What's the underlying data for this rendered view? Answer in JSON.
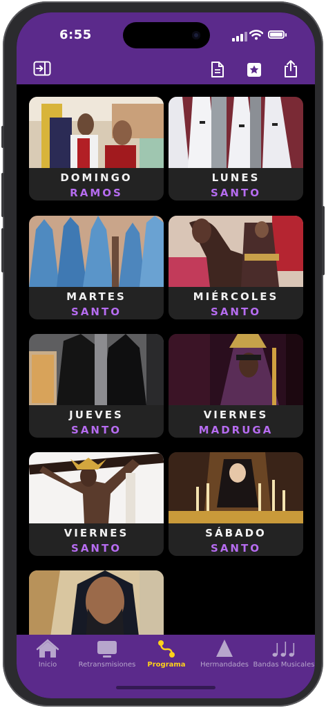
{
  "status": {
    "time": "6:55"
  },
  "toolbar": {
    "icons": [
      "sidebar-toggle-icon",
      "document-icon",
      "star-icon",
      "share-icon"
    ]
  },
  "days": [
    {
      "line1": "DOMINGO",
      "line2": "RAMOS"
    },
    {
      "line1": "LUNES",
      "line2": "SANTO"
    },
    {
      "line1": "MARTES",
      "line2": "SANTO"
    },
    {
      "line1": "MIÉRCOLES",
      "line2": "SANTO"
    },
    {
      "line1": "JUEVES",
      "line2": "SANTO"
    },
    {
      "line1": "VIERNES",
      "line2": "MADRUGA"
    },
    {
      "line1": "VIERNES",
      "line2": "SANTO"
    },
    {
      "line1": "SÁBADO",
      "line2": "SANTO"
    },
    {
      "line1": "",
      "line2": ""
    }
  ],
  "tabbar": {
    "items": [
      {
        "label": "Inicio",
        "icon": "house-icon"
      },
      {
        "label": "Retransmisiones",
        "icon": "tv-icon"
      },
      {
        "label": "Programa",
        "icon": "route-icon",
        "active": true
      },
      {
        "label": "Hermandades",
        "icon": "cone-icon"
      },
      {
        "label": "Bandas Musicales",
        "icon": "music-notes-icon"
      }
    ]
  },
  "colors": {
    "brand": "#5b2a8b",
    "accent_text": "#b66cf0",
    "active_tab": "#ffd21a",
    "card_bg": "#232323"
  }
}
